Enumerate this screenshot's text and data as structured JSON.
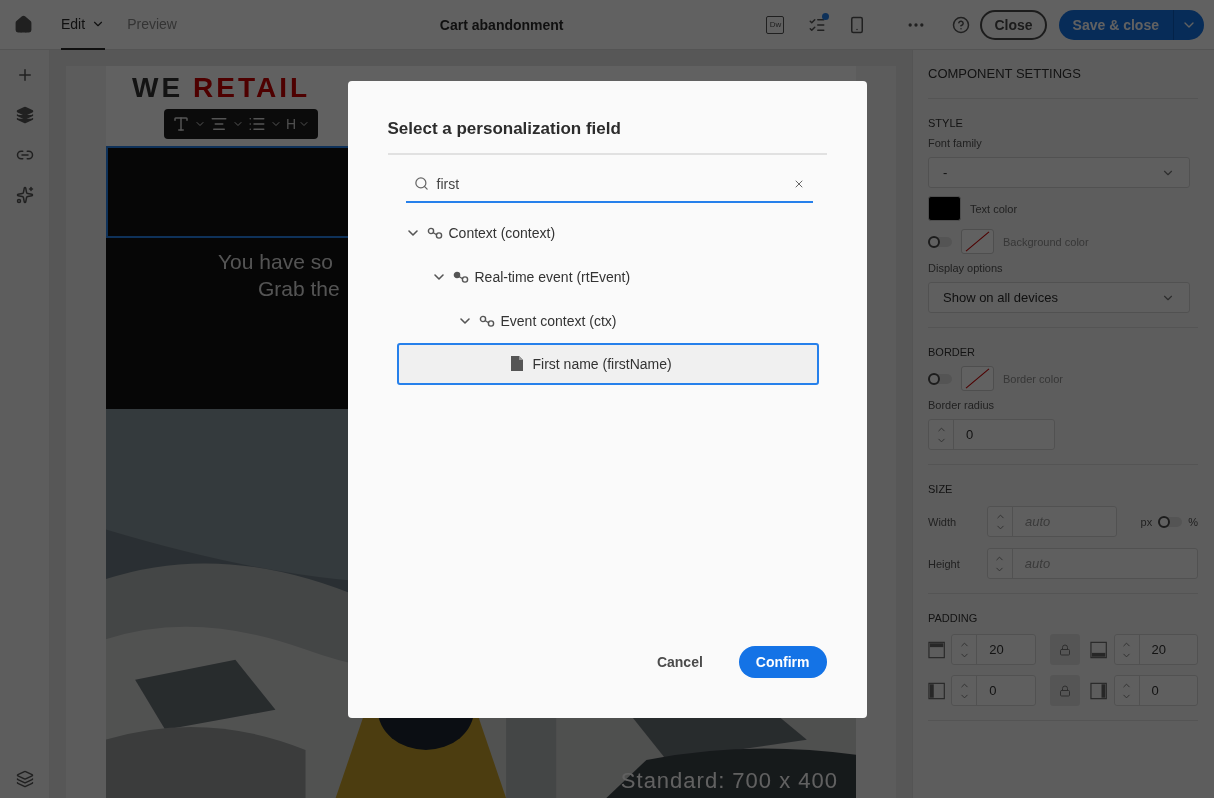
{
  "topbar": {
    "tabs": [
      {
        "label": "Edit",
        "selected": true
      },
      {
        "label": "Preview",
        "selected": false
      }
    ],
    "title": "Cart abandonment",
    "dw_label": "Dw",
    "checklist_badge": true,
    "close": "Close",
    "save": "Save & close"
  },
  "email": {
    "logo_first": "WE",
    "logo_second": "RETAIL",
    "heading_label": "H",
    "hero_lines": [
      "You have so",
      "Grab the"
    ],
    "size_label": "Standard: 700 x 400"
  },
  "settings": {
    "title": "COMPONENT SETTINGS",
    "sections": [
      {
        "kind": "style",
        "title": "STYLE",
        "font_family": {
          "label": "Font family",
          "value": "-"
        },
        "text_color": {
          "label": "Text color",
          "color": "#000000"
        },
        "background_color": {
          "label": "Background color",
          "on": false
        },
        "display": {
          "label": "Display options",
          "value": "Show on all devices"
        }
      },
      {
        "kind": "border",
        "title": "BORDER",
        "border_color": {
          "label": "Border color",
          "on": false
        },
        "radius": {
          "label": "Border radius",
          "value": "0"
        }
      },
      {
        "kind": "size",
        "title": "SIZE",
        "width": {
          "label": "Width",
          "placeholder": "auto"
        },
        "unit": {
          "left": "px",
          "right": "%",
          "on": false
        },
        "height": {
          "label": "Height",
          "placeholder": "auto"
        }
      },
      {
        "kind": "padding",
        "title": "PADDING",
        "fields": [
          {
            "kind": "top",
            "value": "20"
          },
          {
            "kind": "bottom",
            "value": "20"
          },
          {
            "kind": "left",
            "value": "0"
          },
          {
            "kind": "right",
            "value": "0"
          }
        ]
      }
    ]
  },
  "dialog": {
    "title": "Select a personalization field",
    "search": {
      "value": "first"
    },
    "tree": [
      {
        "label": "Context (context)",
        "kind": "link",
        "expanded": true,
        "selected": false,
        "children": [
          {
            "label": "Real-time event (rtEvent)",
            "kind": "event",
            "expanded": true,
            "selected": false,
            "children": [
              {
                "label": "Event context (ctx)",
                "kind": "link",
                "expanded": true,
                "selected": false,
                "children": [
                  {
                    "label": "First name (firstName)",
                    "kind": "field",
                    "selected": true
                  }
                ]
              }
            ]
          }
        ]
      }
    ],
    "cancel": "Cancel",
    "confirm": "Confirm"
  }
}
